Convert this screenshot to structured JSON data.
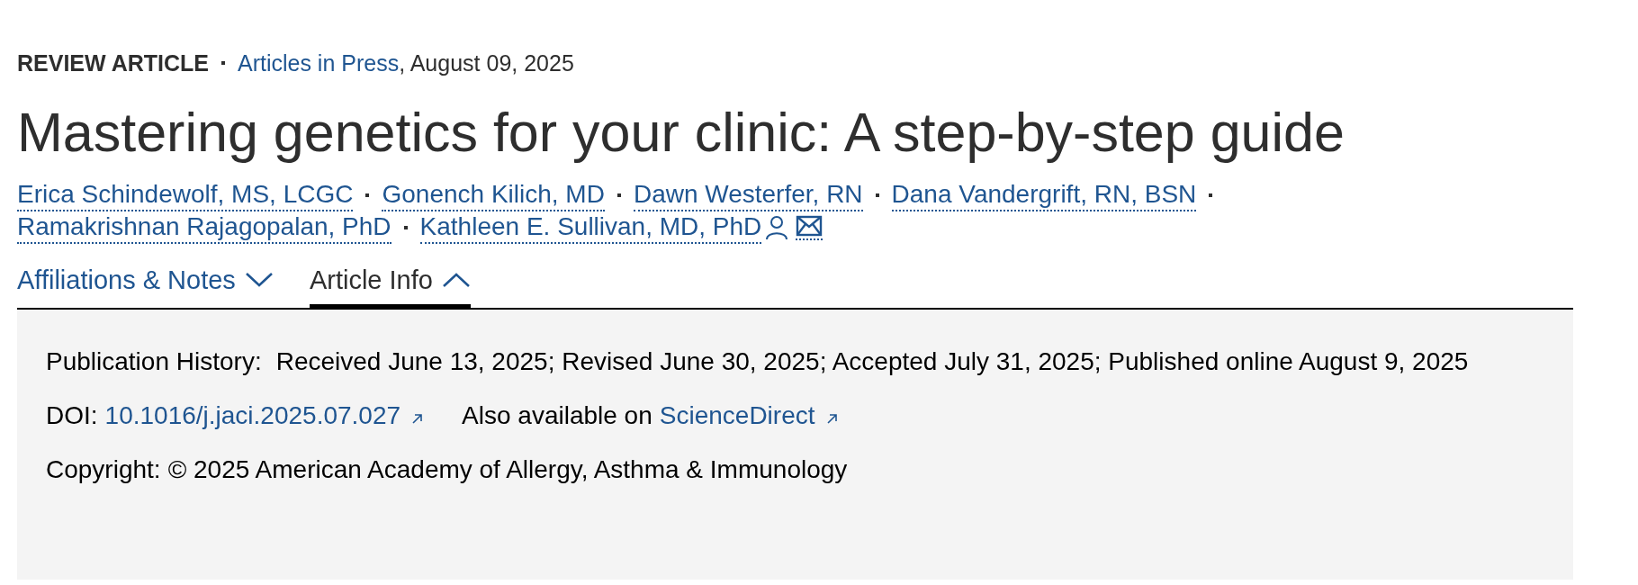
{
  "header": {
    "article_type": "REVIEW ARTICLE",
    "source_link": "Articles in Press",
    "date": ", August 09, 2025"
  },
  "title": "Mastering genetics for your clinic: A step-by-step guide",
  "authors": [
    {
      "name": "Erica Schindewolf, MS, LCGC",
      "corresponding": false
    },
    {
      "name": "Gonench Kilich, MD",
      "corresponding": false
    },
    {
      "name": "Dawn Westerfer, RN",
      "corresponding": false
    },
    {
      "name": "Dana Vandergrift, RN, BSN",
      "corresponding": false
    },
    {
      "name": "Ramakrishnan Rajagopalan, PhD",
      "corresponding": false
    },
    {
      "name": "Kathleen E. Sullivan, MD, PhD",
      "corresponding": true
    }
  ],
  "tabs": [
    {
      "label": "Affiliations & Notes",
      "selected": false,
      "expanded": false
    },
    {
      "label": "Article Info",
      "selected": true,
      "expanded": true
    }
  ],
  "article_info": {
    "publication_history": {
      "label": "Publication History:",
      "value": "Received June 13, 2025; Revised June 30, 2025; Accepted July 31, 2025; Published online August 9, 2025"
    },
    "doi": {
      "label": "DOI:",
      "link": "10.1016/j.jaci.2025.07.027"
    },
    "also_available": {
      "text": "Also available on",
      "link": "ScienceDirect"
    },
    "copyright": {
      "label": "Copyright:",
      "value": "© 2025 American Academy of Allergy, Asthma & Immunology"
    }
  }
}
